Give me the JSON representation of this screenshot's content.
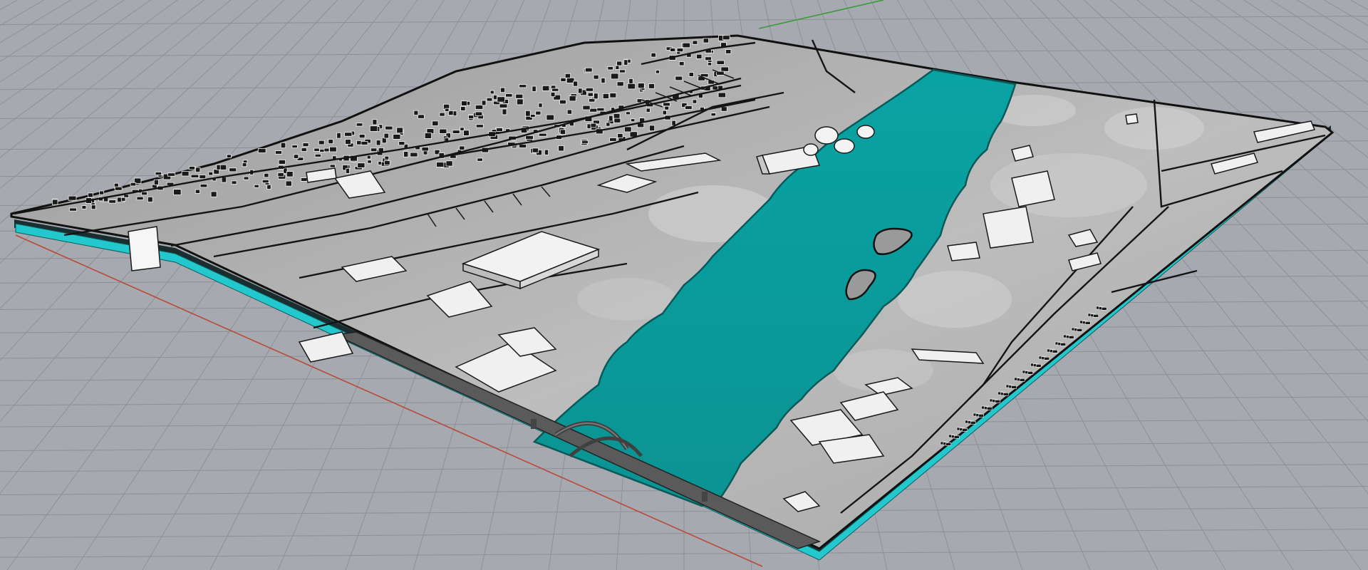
{
  "viewport": {
    "view_type": "perspective",
    "background_color": "#a6a9af",
    "grid_color": "#8d9096",
    "x_axis_color": "#b84a3a",
    "y_axis_color": "#3a9a3a"
  },
  "model": {
    "subject": "river-site-terrain",
    "river_color": "#0d9a9a",
    "base_edge_color": "#22c8cc",
    "terrain_color": "#b7b7b7",
    "building_color": "#eeeeee",
    "road_color": "#1a1a1a",
    "bridge_color": "#5a5a5a"
  }
}
